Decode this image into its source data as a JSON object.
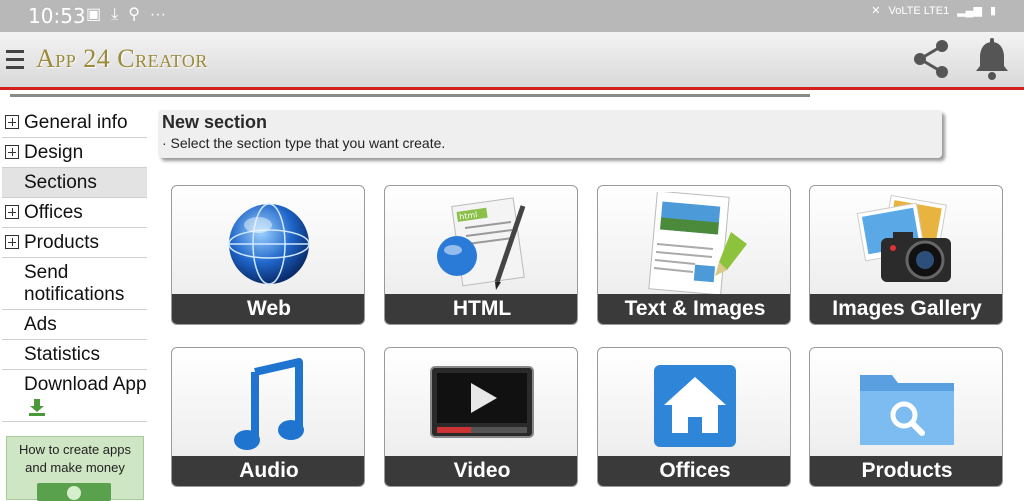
{
  "status_bar": {
    "time": "10:53",
    "network_label": "VoLTE LTE1"
  },
  "app_bar": {
    "title": "App 24 Creator",
    "menu_icon": "hamburger-menu-icon",
    "share_icon": "share-icon",
    "bell_icon": "bell-icon"
  },
  "sidebar": {
    "items": [
      {
        "label": "General info",
        "expandable": true
      },
      {
        "label": "Design",
        "expandable": true
      },
      {
        "label": "Sections",
        "expandable": false,
        "active": true
      },
      {
        "label": "Offices",
        "expandable": true
      },
      {
        "label": "Products",
        "expandable": true
      },
      {
        "label": "Send notifications",
        "expandable": false
      },
      {
        "label": "Ads",
        "expandable": false
      },
      {
        "label": "Statistics",
        "expandable": false
      },
      {
        "label": "Download App",
        "expandable": false
      }
    ],
    "promo_text": "How to create apps and make money"
  },
  "section_header": {
    "title": "New section",
    "subtitle": "· Select the section type that you want create."
  },
  "tiles": [
    {
      "label": "Web",
      "icon": "globe-icon"
    },
    {
      "label": "HTML",
      "icon": "html-document-icon"
    },
    {
      "label": "Text & Images",
      "icon": "text-images-icon"
    },
    {
      "label": "Images Gallery",
      "icon": "camera-photos-icon"
    },
    {
      "label": "Audio",
      "icon": "music-note-icon"
    },
    {
      "label": "Video",
      "icon": "video-player-icon"
    },
    {
      "label": "Offices",
      "icon": "home-icon"
    },
    {
      "label": "Products",
      "icon": "folder-search-icon"
    }
  ],
  "colors": {
    "accent_red": "#d21f1f",
    "title_gold": "#9a8a3a",
    "label_bar": "#3a3a3a"
  }
}
